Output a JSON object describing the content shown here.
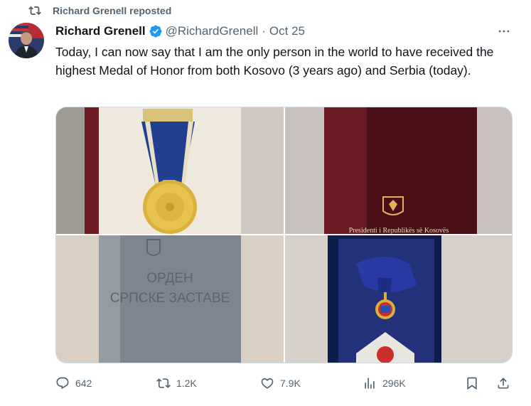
{
  "repost": {
    "label": "Richard Grenell reposted",
    "icon": "repost-icon"
  },
  "author": {
    "name": "Richard Grenell",
    "handle": "@RichardGrenell",
    "separator": "·",
    "date": "Oct 25",
    "verified_color": "#1d9bf0"
  },
  "tweet": {
    "text": "Today, I can now say that I am the only person in the world to have received the highest Medal of Honor from both Kosovo (3 years ago) and Serbia (today)."
  },
  "media": {
    "images": [
      {
        "name": "gold-medal-blue-ribbon-photo"
      },
      {
        "name": "kosovo-presidency-box-photo",
        "caption": "Presidenti i Republikës së Kosovës"
      },
      {
        "name": "serbian-flag-order-box-photo",
        "text_line1": "ОРДЕН",
        "text_line2": "СРПСКЕ ЗАСТАВЕ"
      },
      {
        "name": "serbian-order-medal-photo"
      }
    ]
  },
  "actions": {
    "replies": "642",
    "reposts": "1.2K",
    "likes": "7.9K",
    "views": "296K"
  },
  "colors": {
    "secondary_text": "#536471",
    "primary_text": "#0f1419",
    "border": "#cfd9de"
  }
}
